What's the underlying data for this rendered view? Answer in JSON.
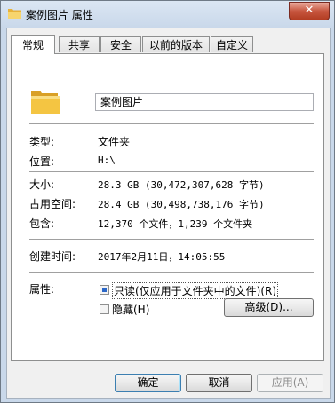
{
  "window": {
    "title": "案例图片 属性",
    "close_glyph": "✕"
  },
  "tabs": [
    {
      "label": "常规",
      "active": true
    },
    {
      "label": "共享",
      "active": false
    },
    {
      "label": "安全",
      "active": false
    },
    {
      "label": "以前的版本",
      "active": false
    },
    {
      "label": "自定义",
      "active": false
    }
  ],
  "general": {
    "name": "案例图片",
    "type_label": "类型:",
    "type_value": "文件夹",
    "location_label": "位置:",
    "location_value": "H:\\",
    "size_label": "大小:",
    "size_value": "28.3 GB (30,472,307,628 字节)",
    "size_on_disk_label": "占用空间:",
    "size_on_disk_value": "28.4 GB (30,498,738,176 字节)",
    "contains_label": "包含:",
    "contains_value": "12,370 个文件，1,239 个文件夹",
    "created_label": "创建时间:",
    "created_value": "2017年2月11日，14:05:55",
    "attributes_label": "属性:",
    "readonly_label": "只读(仅应用于文件夹中的文件)(R)",
    "readonly_state": "indeterminate",
    "hidden_label": "隐藏(H)",
    "hidden_state": "unchecked",
    "advanced_button": "高级(D)..."
  },
  "buttons": {
    "ok": "确定",
    "cancel": "取消",
    "apply": "应用(A)"
  },
  "colors": {
    "folder_yellow": "#f4c542",
    "close_red": "#c7563f",
    "checkbox_indeterminate": "#2b67c7"
  }
}
